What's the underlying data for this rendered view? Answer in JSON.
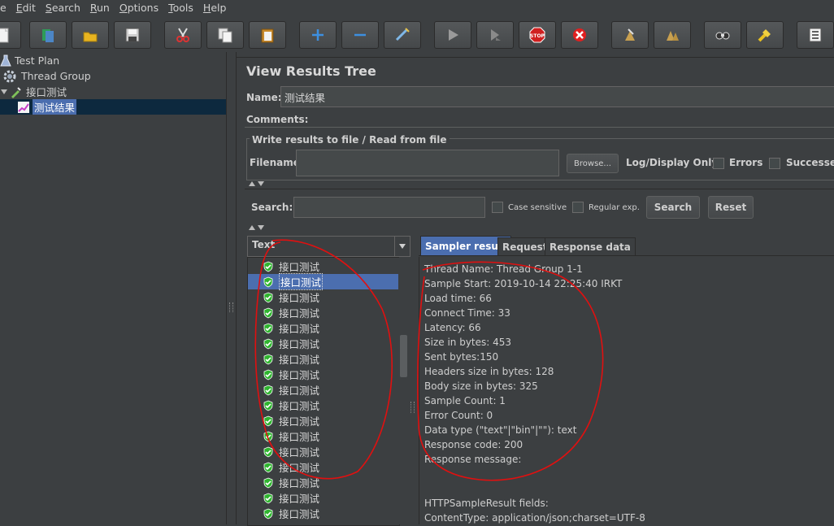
{
  "menu": {
    "items": [
      {
        "accel": "",
        "rest": "e"
      },
      {
        "accel": "E",
        "rest": "dit"
      },
      {
        "accel": "S",
        "rest": "earch"
      },
      {
        "accel": "R",
        "rest": "un"
      },
      {
        "accel": "O",
        "rest": "ptions"
      },
      {
        "accel": "T",
        "rest": "ools"
      },
      {
        "accel": "H",
        "rest": "elp"
      }
    ]
  },
  "toolbar": {
    "buttons": [
      "new-icon",
      "templates-icon",
      "open-icon",
      "save-icon",
      "cut-icon",
      "copy-icon",
      "paste-icon",
      "expand-icon",
      "collapse-icon",
      "toggle-icon",
      "start-icon",
      "start-no-pauses-icon",
      "stop-icon",
      "shutdown-icon",
      "clear-icon",
      "clear-all-icon",
      "search-icon",
      "reset-search-icon",
      "function-helper-icon"
    ]
  },
  "tree": {
    "items": [
      {
        "label": "Test Plan"
      },
      {
        "label": "Thread Group"
      },
      {
        "label": "接口测试"
      },
      {
        "label": "测试结果"
      }
    ]
  },
  "panel": {
    "title": "View Results Tree",
    "name_label": "Name:",
    "name_value": "测试结果",
    "comments_label": "Comments:",
    "file_group_title": "Write results to file / Read from file",
    "filename_label": "Filename",
    "browse_label": "Browse...",
    "log_display_label": "Log/Display Only:",
    "errors_label": "Errors",
    "successes_label": "Successes"
  },
  "search": {
    "label": "Search:",
    "case_sensitive": "Case sensitive",
    "regular_exp": "Regular exp.",
    "search_button": "Search",
    "reset_button": "Reset"
  },
  "renderer": {
    "selected": "Text"
  },
  "results": {
    "items": [
      "接口测试",
      "接口测试",
      "接口测试",
      "接口测试",
      "接口测试",
      "接口测试",
      "接口测试",
      "接口测试",
      "接口测试",
      "接口测试",
      "接口测试",
      "接口测试",
      "接口测试",
      "接口测试",
      "接口测试",
      "接口测试",
      "接口测试"
    ],
    "selected_index": 1
  },
  "tabs": [
    "Sampler result",
    "Request",
    "Response data"
  ],
  "details": {
    "lines": [
      "Thread Name: Thread Group 1-1",
      "Sample Start: 2019-10-14 22:25:40 IRKT",
      "Load time: 66",
      "Connect Time: 33",
      "Latency: 66",
      "Size in bytes: 453",
      "Sent bytes:150",
      "Headers size in bytes: 128",
      "Body size in bytes: 325",
      "Sample Count: 1",
      "Error Count: 0",
      "Data type (\"text\"|\"bin\"|\"\"): text",
      "Response code: 200",
      "Response message: ",
      "",
      "",
      "HTTPSampleResult fields:",
      "ContentType: application/json;charset=UTF-8"
    ]
  },
  "colors": {
    "background": "#3c3f41",
    "selection": "#4b6eaf",
    "annotation": "#e01010",
    "success": "#2fb52f"
  }
}
